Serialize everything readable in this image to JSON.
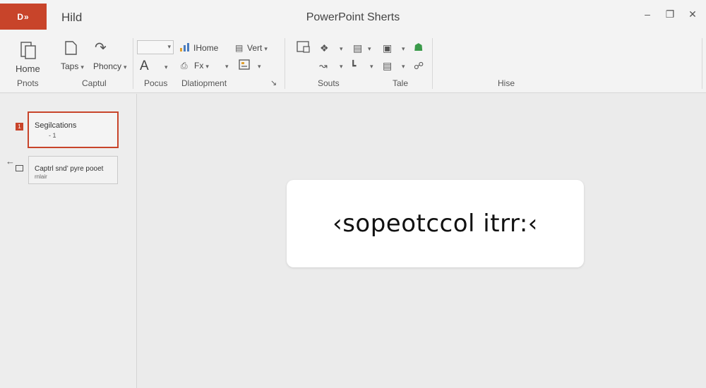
{
  "app": {
    "logo_text": "D»",
    "document_name": "Hild",
    "title": "PowerPoint Sherts",
    "controls": {
      "minimize": "–",
      "restore": "❐",
      "close": "✕"
    }
  },
  "ribbon": {
    "home_label": "Home",
    "taps_label": "Taps",
    "phoncy_label": "Phoncy",
    "font_letter": "A",
    "ihome_label": "IHome",
    "vert_label": "Vert",
    "fx_label": "Fx",
    "groups": {
      "photos": "Pnots",
      "captul": "Captul",
      "pocus": "Pocus",
      "development": "Dlatiopment",
      "souts": "Souts",
      "tale": "Tale",
      "hise": "Hise"
    },
    "icons": {
      "clipboard": "clipboard-icon",
      "page": "page-icon",
      "redo": "redo-icon",
      "bars": "bar-chart-icon",
      "text": "text-icon",
      "palette": "palette-icon",
      "expand": "dialog-launcher-icon"
    }
  },
  "slides": [
    {
      "number": "1",
      "title": "Segilcations",
      "subtitle": "-  1",
      "selected": true
    },
    {
      "title": "Captrl snd’ pyre pooet",
      "subtitle": "rnlair",
      "selected": false
    }
  ],
  "editor": {
    "textbox_text": "‹sopeotccol itrr:‹"
  },
  "colors": {
    "accent": "#c8442a",
    "background": "#ebebeb",
    "ribbon": "#f3f3f3"
  }
}
